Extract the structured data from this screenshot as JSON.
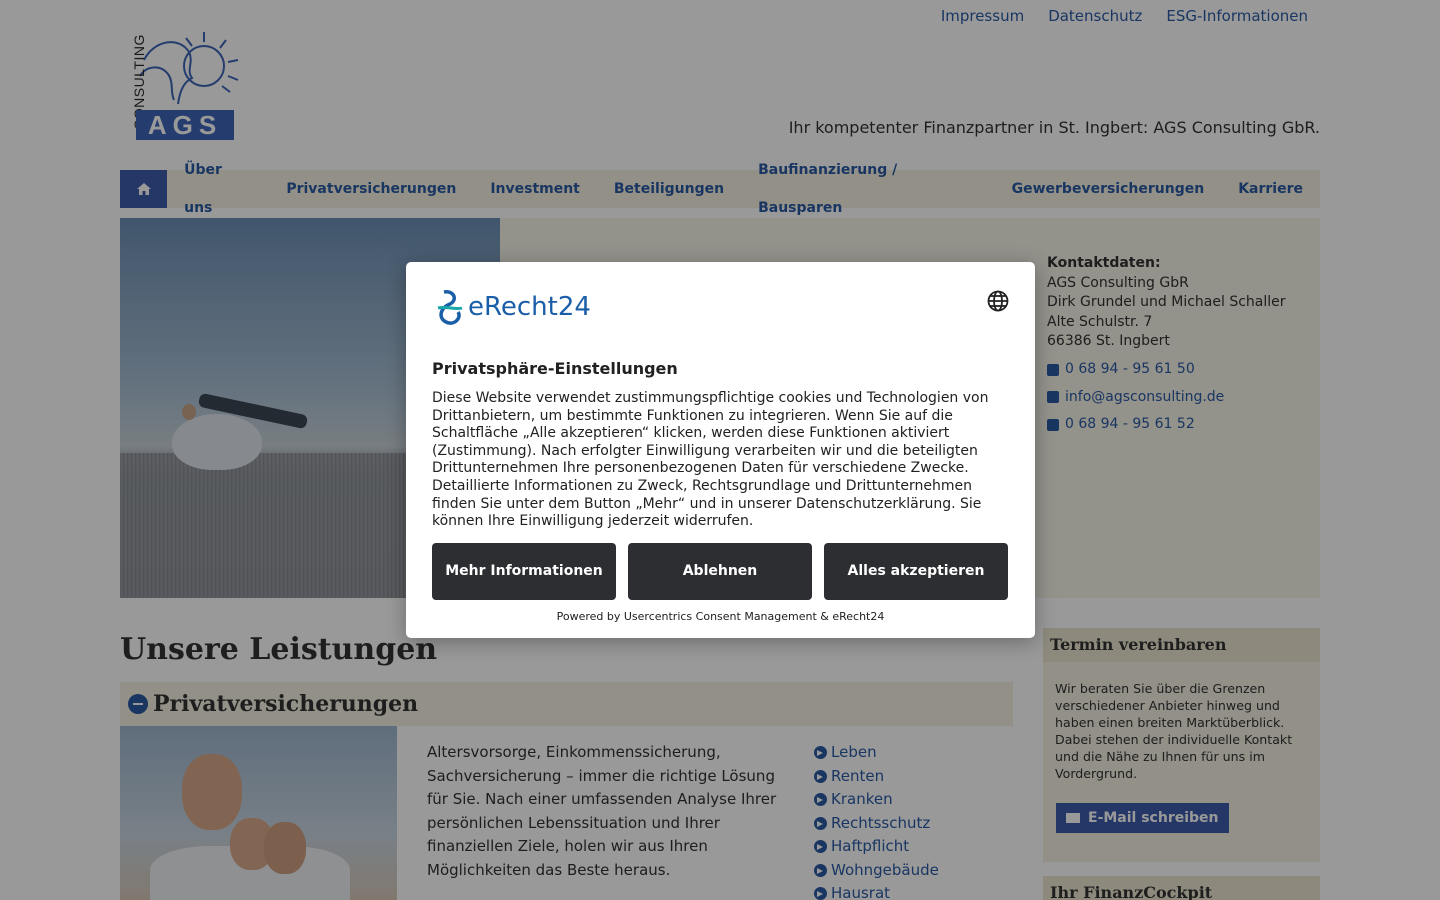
{
  "top_links": [
    "Impressum",
    "Datenschutz",
    "ESG-Informationen"
  ],
  "logo": {
    "vertical_text": "CONSULTING",
    "box_text": "AGS"
  },
  "tagline": "Ihr kompetenter Finanzpartner in St. Ingbert: AGS Consulting GbR.",
  "nav": {
    "home_icon": "home-icon",
    "items": [
      "Über uns",
      "Privatversicherungen",
      "Investment",
      "Beteiligungen",
      "Baufinanzierung / Bausparen",
      "Gewerbeversicherungen",
      "Karriere"
    ]
  },
  "contact": {
    "label": "Kontaktdaten:",
    "company": "AGS Consulting GbR",
    "names": "Dirk Grundel und Michael Schaller",
    "street": "Alte Schulstr. 7",
    "city": "66386 St. Ingbert",
    "phone": "0 68 94 - 95 61 50",
    "email": "info@agsconsulting.de",
    "fax": "0 68 94 - 95 61 52"
  },
  "main": {
    "heading": "Unsere Leistungen",
    "accordion_title": "Privatversicherungen",
    "description": "Altersvorsorge, Einkommenssicherung, Sachversicherung – immer die richtige Lösung für Sie. Nach einer umfassenden Analyse Ihrer persönlichen Lebenssituation und Ihrer finanziellen Ziele, holen wir aus Ihren Möglichkeiten das Beste heraus.",
    "links": [
      "Leben",
      "Renten",
      "Kranken",
      "Rechtsschutz",
      "Haftpflicht",
      "Wohngebäude",
      "Hausrat"
    ]
  },
  "sidebar": {
    "termin_title": "Termin vereinbaren",
    "termin_text": "Wir beraten Sie über die Grenzen verschiedener Anbieter hinweg und haben einen breiten Marktüberblick. Dabei stehen der individuelle Kontakt und die Nähe zu Ihnen für uns im Vordergrund.",
    "termin_button": "E-Mail schreiben",
    "cockpit_title": "Ihr FinanzCockpit"
  },
  "consent": {
    "brand": "eRecht24",
    "title": "Privatsphäre-Einstellungen",
    "text": "Diese Website verwendet zustimmungspflichtige cookies und Technologien von Drittanbietern, um bestimmte Funktionen zu integrieren. Wenn Sie auf die Schaltfläche „Alle akzeptieren“ klicken, werden diese Funktionen aktiviert (Zustimmung). Nach erfolgter Einwilligung verarbeiten wir und die beteiligten Drittunternehmen Ihre personenbezogenen Daten für verschiedene Zwecke. Detaillierte Informationen zu Zweck, Rechtsgrundlage und Drittunternehmen finden Sie unter dem Button „Mehr“ und in unserer Datenschutzerklärung. Sie können Ihre Einwilligung jederzeit widerrufen.",
    "btn_more": "Mehr Informationen",
    "btn_deny": "Ablehnen",
    "btn_accept": "Alles akzeptieren",
    "powered": "Powered by Usercentrics Consent Management & eRecht24"
  },
  "colors": {
    "link": "#2a5aa3",
    "nav_bg": "#f4f0e1",
    "home_bg": "#3e5caa",
    "button_dark": "#2c2e31"
  }
}
